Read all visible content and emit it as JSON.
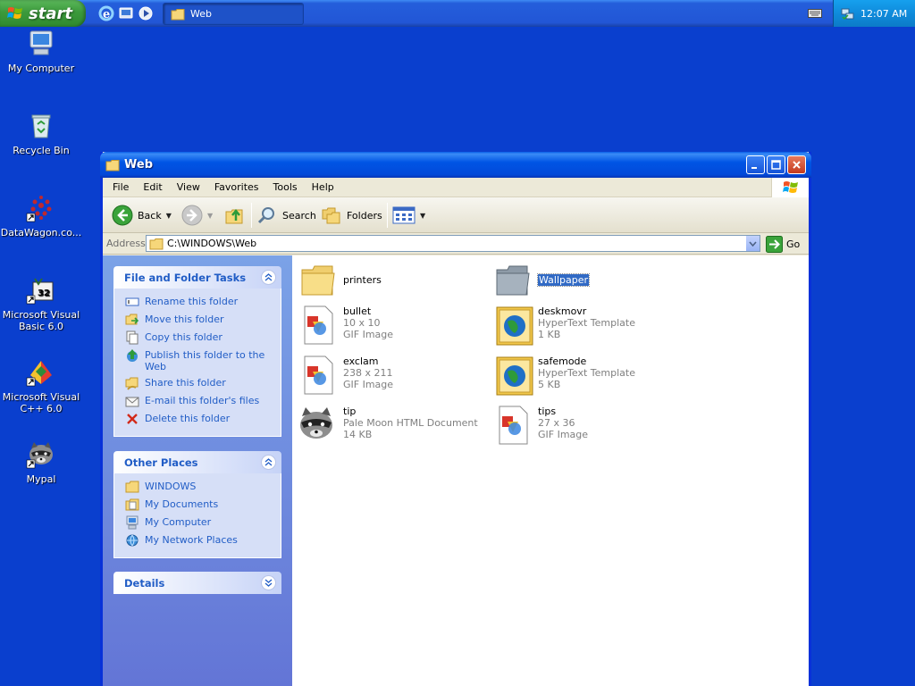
{
  "taskbar": {
    "start_label": "start",
    "task_button_label": "Web",
    "clock": "12:07 AM"
  },
  "desktop_icons": [
    {
      "label": "My Computer",
      "icon": "computer-icon"
    },
    {
      "label": "Recycle Bin",
      "icon": "recycle-bin-icon"
    },
    {
      "label": "DataWagon.co...",
      "icon": "datawagon-icon"
    },
    {
      "label": "Microsoft Visual Basic 6.0",
      "icon": "visual-basic-icon"
    },
    {
      "label": "Microsoft Visual C++ 6.0",
      "icon": "visual-cpp-icon"
    },
    {
      "label": "Mypal",
      "icon": "mypal-icon"
    }
  ],
  "window": {
    "title": "Web",
    "menu": [
      "File",
      "Edit",
      "View",
      "Favorites",
      "Tools",
      "Help"
    ],
    "toolbar": {
      "back_label": "Back",
      "search_label": "Search",
      "folders_label": "Folders"
    },
    "address": {
      "label": "Address",
      "value": "C:\\WINDOWS\\Web",
      "go_label": "Go"
    }
  },
  "taskpane": {
    "file_tasks": {
      "title": "File and Folder Tasks",
      "items": [
        "Rename this folder",
        "Move this folder",
        "Copy this folder",
        "Publish this folder to the Web",
        "Share this folder",
        "E-mail this folder's files",
        "Delete this folder"
      ]
    },
    "other_places": {
      "title": "Other Places",
      "items": [
        "WINDOWS",
        "My Documents",
        "My Computer",
        "My Network Places"
      ]
    },
    "details": {
      "title": "Details"
    }
  },
  "files": [
    {
      "name": "printers",
      "line1": "",
      "line2": "",
      "icon": "folder-icon"
    },
    {
      "name": "Wallpaper",
      "line1": "",
      "line2": "",
      "icon": "folder-icon",
      "selected": true
    },
    {
      "name": "bullet",
      "line1": "10 x 10",
      "line2": "GIF Image",
      "icon": "gif-image-icon"
    },
    {
      "name": "deskmovr",
      "line1": "HyperText Template",
      "line2": "1 KB",
      "icon": "hypertext-template-icon"
    },
    {
      "name": "exclam",
      "line1": "238 x 211",
      "line2": "GIF Image",
      "icon": "gif-image-icon"
    },
    {
      "name": "safemode",
      "line1": "HyperText Template",
      "line2": "5 KB",
      "icon": "hypertext-template-icon"
    },
    {
      "name": "tip",
      "line1": "Pale Moon HTML Document",
      "line2": "14 KB",
      "icon": "pale-moon-document-icon"
    },
    {
      "name": "tips",
      "line1": "27 x 36",
      "line2": "GIF Image",
      "icon": "gif-image-icon"
    }
  ],
  "colors": {
    "desktop": "#0A3FCE",
    "taskpane_link": "#215DC6",
    "selection": "#316AC5"
  }
}
